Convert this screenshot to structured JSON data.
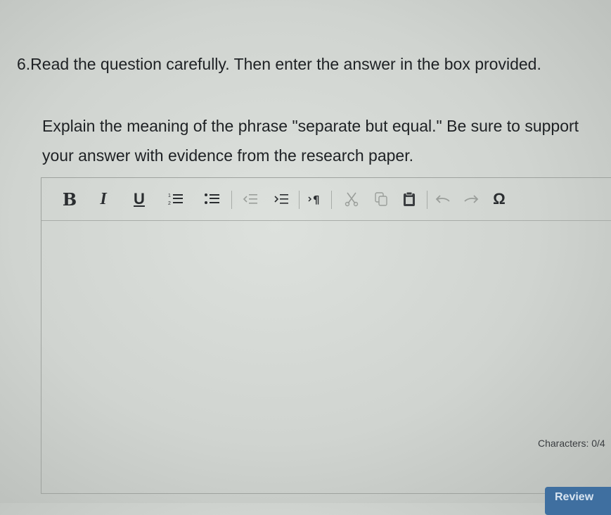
{
  "question": {
    "number_and_instruction": "6.Read the question carefully. Then enter the answer in the box provided.",
    "prompt": "Explain the meaning of the phrase \"separate but equal.\" Be sure to support your answer with evidence from the research paper."
  },
  "toolbar": {
    "bold_label": "B",
    "italic_label": "I",
    "underline_label": "U",
    "special_char_label": "Ω",
    "items": [
      {
        "name": "bold",
        "icon": "bold-icon"
      },
      {
        "name": "italic",
        "icon": "italic-icon"
      },
      {
        "name": "underline",
        "icon": "underline-icon"
      },
      {
        "name": "numbered-list",
        "icon": "numbered-list-icon"
      },
      {
        "name": "bulleted-list",
        "icon": "bulleted-list-icon"
      },
      {
        "name": "decrease-indent",
        "icon": "outdent-icon",
        "enabled": false
      },
      {
        "name": "increase-indent",
        "icon": "indent-icon"
      },
      {
        "name": "paragraph-direction",
        "icon": "paragraph-icon"
      },
      {
        "name": "cut",
        "icon": "scissors-icon",
        "enabled": false
      },
      {
        "name": "copy",
        "icon": "copy-icon",
        "enabled": false
      },
      {
        "name": "paste",
        "icon": "clipboard-icon"
      },
      {
        "name": "undo",
        "icon": "undo-icon",
        "enabled": false
      },
      {
        "name": "redo",
        "icon": "redo-icon",
        "enabled": false
      },
      {
        "name": "special-characters",
        "icon": "omega-icon"
      }
    ]
  },
  "editor": {
    "value": "",
    "characters_label": "Characters: 0/4"
  },
  "footer": {
    "review_label": "Review"
  },
  "colors": {
    "background": "#d0d4d0",
    "text": "#1e2124",
    "border": "#9ea29e",
    "button": "#3f6fa0"
  }
}
